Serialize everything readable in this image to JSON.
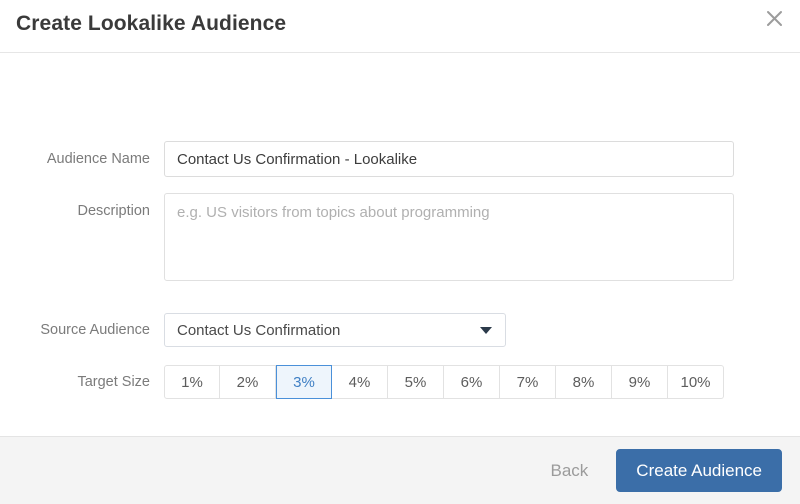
{
  "dialog": {
    "title": "Create Lookalike Audience",
    "close_icon": "close-icon"
  },
  "form": {
    "audience_name": {
      "label": "Audience Name",
      "value": "Contact Us Confirmation - Lookalike",
      "placeholder": ""
    },
    "description": {
      "label": "Description",
      "value": "",
      "placeholder": "e.g. US visitors from topics about programming"
    },
    "source_audience": {
      "label": "Source Audience",
      "selected": "Contact Us Confirmation",
      "caret_icon": "chevron-down-icon"
    },
    "target_size": {
      "label": "Target Size",
      "selected": "3%",
      "options": [
        "1%",
        "2%",
        "3%",
        "4%",
        "5%",
        "6%",
        "7%",
        "8%",
        "9%",
        "10%"
      ]
    }
  },
  "footer": {
    "back_label": "Back",
    "submit_label": "Create Audience"
  },
  "colors": {
    "accent": "#3b6ea8",
    "selected_border": "#4a90d9",
    "selected_bg": "#eef5fc",
    "selected_text": "#3f7fc4",
    "label_text": "#7b7b7b",
    "title_text": "#3a3a3a",
    "footer_bg": "#f4f4f4",
    "back_text": "#9b9b9b"
  }
}
